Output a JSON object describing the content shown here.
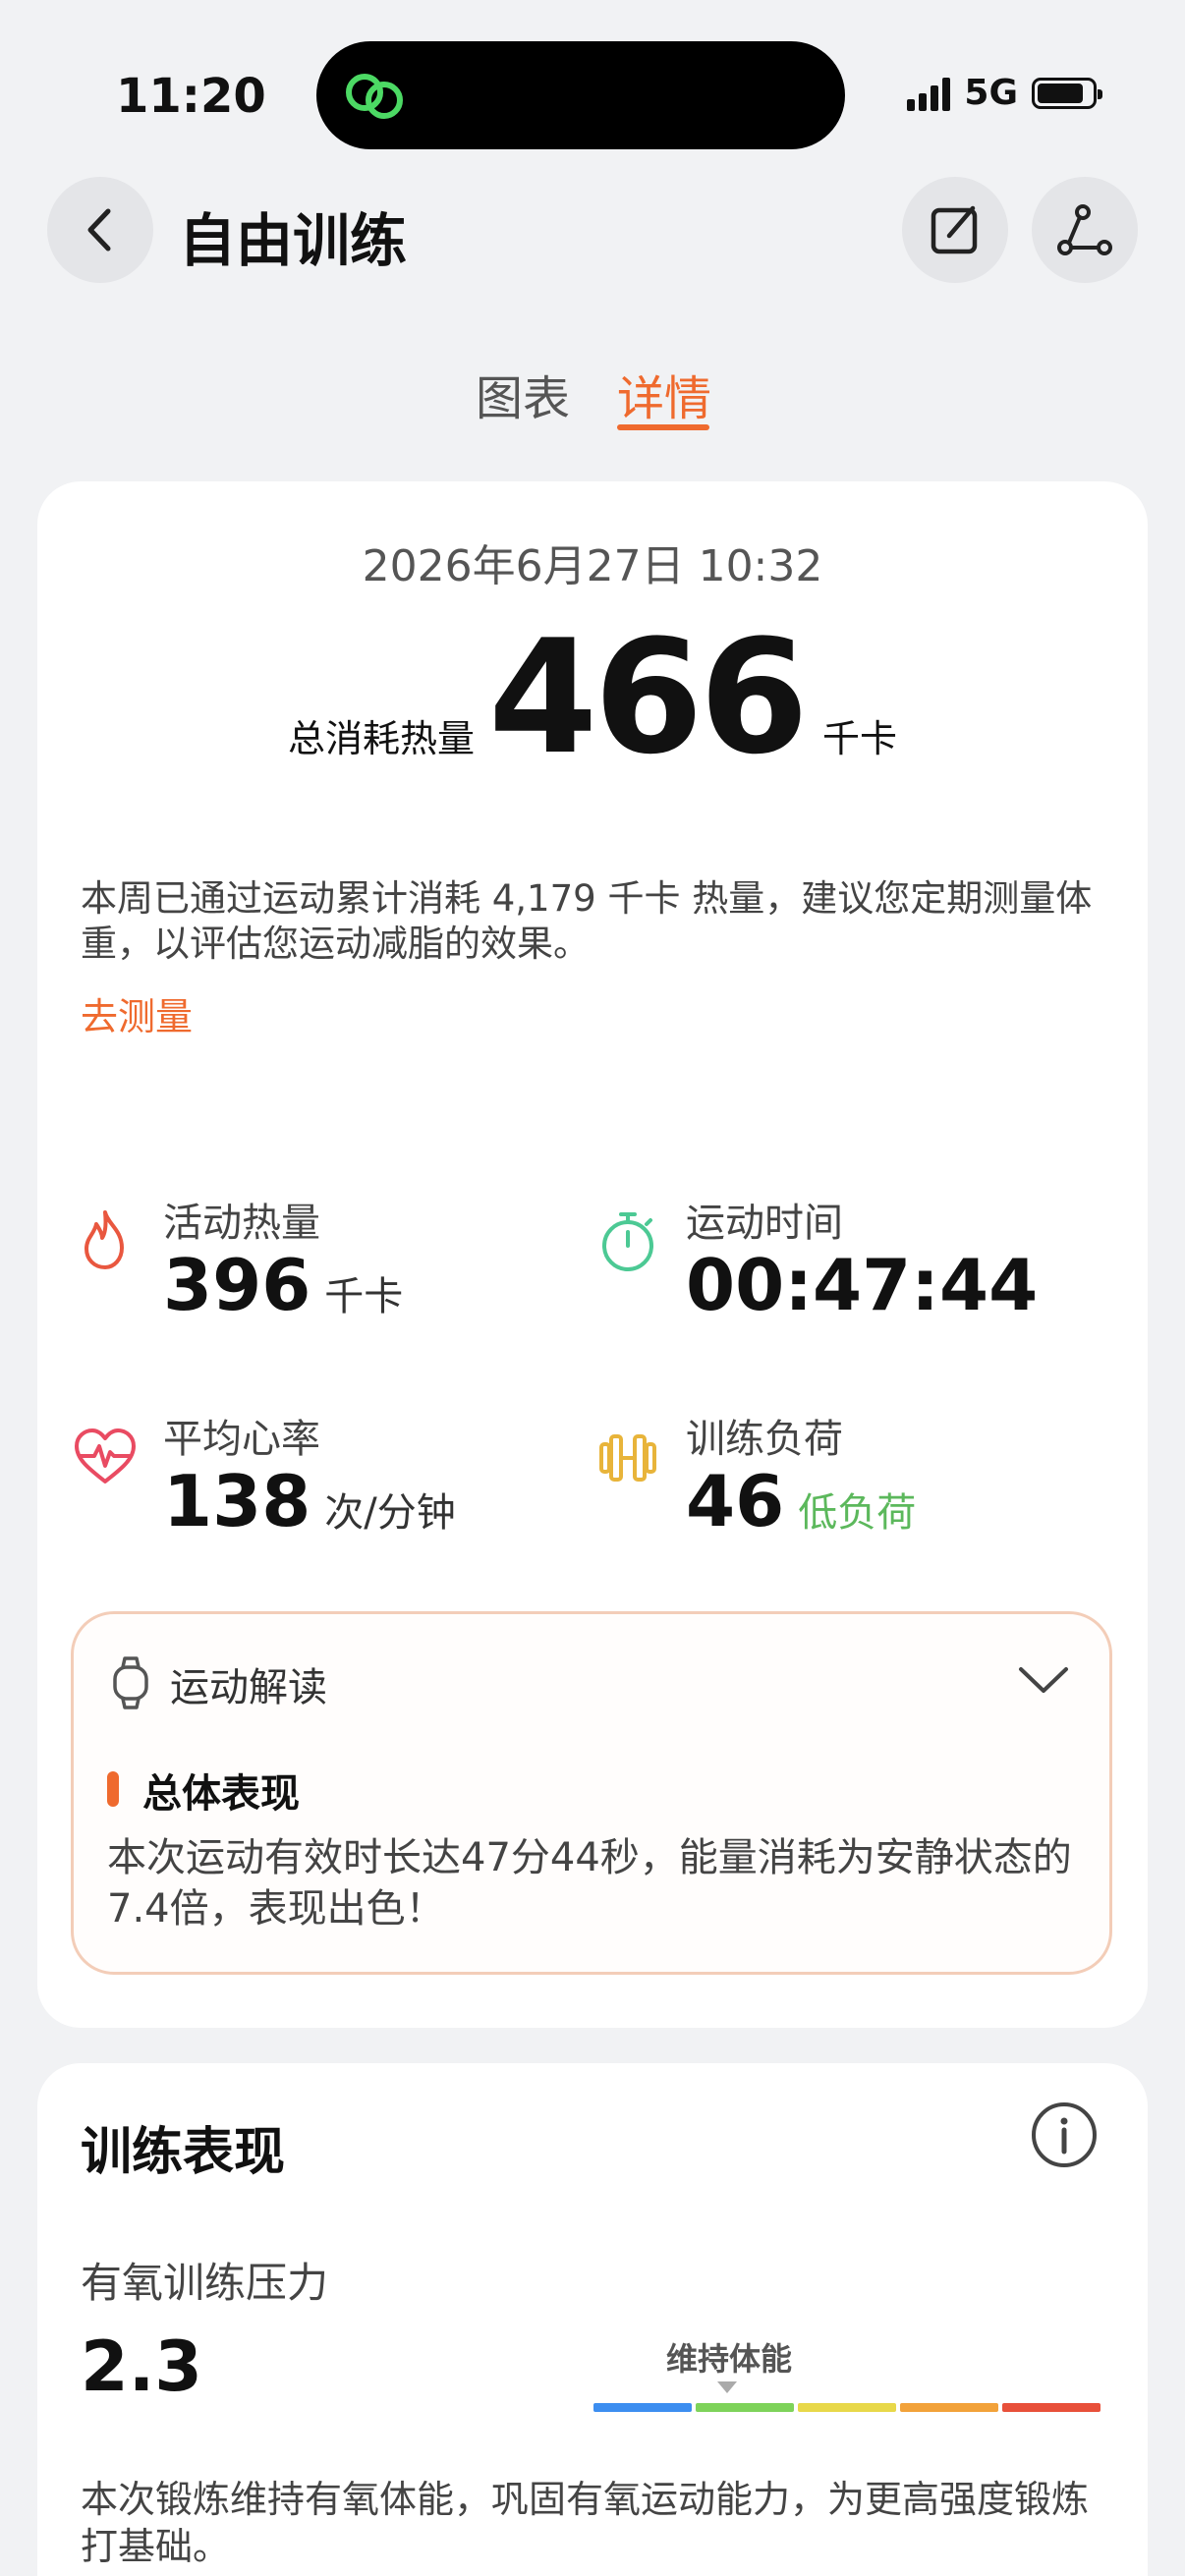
{
  "status_bar": {
    "time": "11:20",
    "network": "5G",
    "battery_level": 0.85,
    "island_icon": "link-rings-icon"
  },
  "header": {
    "title": "自由训练",
    "back_icon": "chevron-left-icon",
    "edit_icon": "edit-icon",
    "share_icon": "share-icon"
  },
  "tabs": [
    {
      "label": "图表",
      "active": false
    },
    {
      "label": "详情",
      "active": true
    }
  ],
  "summary": {
    "datetime": "2026年6月27日 10:32",
    "total_label": "总消耗热量",
    "total_value": "466",
    "total_unit": "千卡",
    "weekly_text": "本周已通过运动累计消耗 4,179 千卡 热量，建议您定期测量体重，以评估您运动减脂的效果。",
    "measure_link": "去测量"
  },
  "metrics": {
    "active_calories": {
      "label": "活动热量",
      "value": "396",
      "unit": "千卡",
      "icon": "flame-icon",
      "color": "#e9573f"
    },
    "duration": {
      "label": "运动时间",
      "value": "00:47:44",
      "icon": "stopwatch-icon",
      "color": "#4cc994"
    },
    "heart_rate": {
      "label": "平均心率",
      "value": "138",
      "unit": "次/分钟",
      "icon": "heart-rate-icon",
      "color": "#e94b62"
    },
    "training_load": {
      "label": "训练负荷",
      "value": "46",
      "unit": "低负荷",
      "icon": "dumbbell-icon",
      "color": "#e8b43a"
    }
  },
  "analysis": {
    "title": "运动解读",
    "section_title": "总体表现",
    "text": "本次运动有效时长达47分44秒，能量消耗为安静状态的7.4倍，表现出色！"
  },
  "performance": {
    "title": "训练表现",
    "aerobic_label": "有氧训练压力",
    "aerobic_value": "2.3",
    "level_label": "维持体能",
    "level_colors": [
      "#3d8ef0",
      "#7ed35a",
      "#e8d84a",
      "#f2a23a",
      "#e8503a"
    ],
    "level_index": 1,
    "text": "本次锻炼维持有氧体能，巩固有氧运动能力，为更高强度锻炼打基础。"
  }
}
